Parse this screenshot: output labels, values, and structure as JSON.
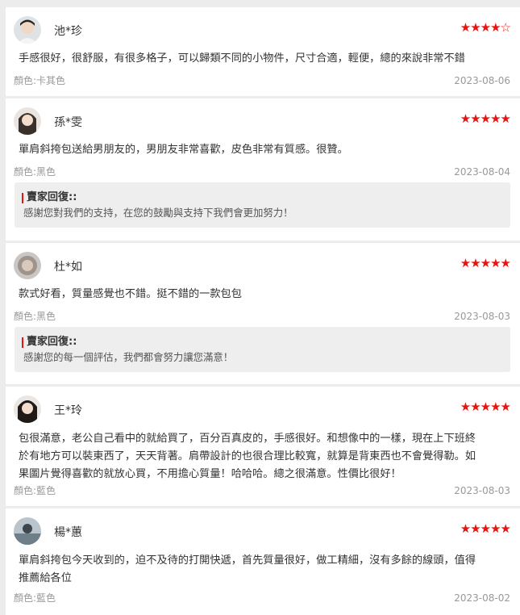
{
  "reviews": [
    {
      "name": "池*珍",
      "stars": [
        "★",
        "★",
        "★",
        "★",
        "☆"
      ],
      "rating": 4,
      "text": "手感很好，很舒服，有很多格子，可以歸類不同的小物件，尺寸合適，輕便，總的來說非常不錯",
      "variant": "顏色:卡其色",
      "date": "2023-08-06"
    },
    {
      "name": "孫*雯",
      "stars": [
        "★",
        "★",
        "★",
        "★",
        "★"
      ],
      "rating": 5,
      "text": "單肩斜挎包送給男朋友的，男朋友非常喜歡，皮色非常有質感。很贊。",
      "variant": "顏色:黑色",
      "date": "2023-08-04",
      "reply_title": "賣家回復::",
      "reply_text": "感謝您對我們的支持，在您的鼓勵與支持下我們會更加努力！"
    },
    {
      "name": "杜*如",
      "stars": [
        "★",
        "★",
        "★",
        "★",
        "★"
      ],
      "rating": 5,
      "text": "款式好看，質量感覺也不錯。挺不錯的一款包包",
      "variant": "顏色:黑色",
      "date": "2023-08-03",
      "reply_title": "賣家回復::",
      "reply_text": "感謝您的每一個評估，我們都會努力讓您滿意！"
    },
    {
      "name": "王*玲",
      "stars": [
        "★",
        "★",
        "★",
        "★",
        "★"
      ],
      "rating": 5,
      "text_lines": [
        "包很滿意，老公自己看中的就給買了，百分百真皮的，手感很好。和想像中的一樣，現在上下班終",
        "於有地方可以裝東西了，天天背著。肩帶設計的也很合理比較寬，就算是背東西也不會覺得勒。如",
        "果圖片覺得喜歡的就放心買，不用擔心質量！哈哈哈。總之很滿意。性價比很好！"
      ],
      "variant": "顏色:藍色",
      "date": "2023-08-03"
    },
    {
      "name": "楊*蕙",
      "stars": [
        "★",
        "★",
        "★",
        "★",
        "★"
      ],
      "rating": 5,
      "text_lines": [
        "單肩斜挎包今天收到的，迫不及待的打開快遞，首先質量很好，做工精細，沒有多餘的線頭，值得",
        "推薦給各位"
      ],
      "variant": "顏色:藍色",
      "date": "2023-08-02"
    }
  ],
  "colors": {
    "star": "#e8150f",
    "reply_accent": "#e8150f",
    "meta": "#999999",
    "background": "#ececec"
  }
}
